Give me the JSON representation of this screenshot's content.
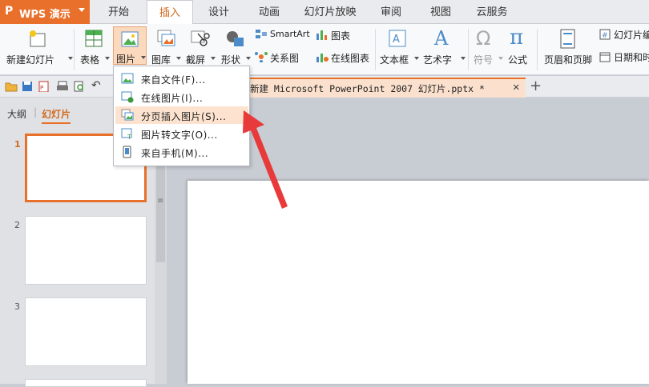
{
  "app": {
    "logo": "P",
    "name": "WPS 演示"
  },
  "tabs": [
    "开始",
    "插入",
    "设计",
    "动画",
    "幻灯片放映",
    "审阅",
    "视图",
    "云服务"
  ],
  "active_tab": "插入",
  "ribbon": {
    "new_slide": "新建幻灯片",
    "table": "表格",
    "picture": "图片",
    "gallery": "图库",
    "screenshot": "截屏",
    "shape": "形状",
    "smartart": "SmartArt",
    "chart": "图表",
    "relation": "关系图",
    "online_chart": "在线图表",
    "textbox": "文本框",
    "wordart": "艺术字",
    "symbol": "符号",
    "formula": "公式",
    "header_footer": "页眉和页脚",
    "slide_number": "幻灯片编",
    "datetime": "日期和时"
  },
  "document": {
    "tab_title": "新建 Microsoft PowerPoint 2007 幻灯片.pptx *"
  },
  "panel_tabs": {
    "outline": "大纲",
    "slides": "幻灯片"
  },
  "slide_numbers": [
    "1",
    "2",
    "3"
  ],
  "picture_menu": {
    "items": [
      "来自文件(F)...",
      "在线图片(I)...",
      "分页插入图片(S)...",
      "图片转文字(O)...",
      "来自手机(M)..."
    ],
    "highlighted_index": 2
  },
  "colors": {
    "accent": "#e8702a",
    "arrow": "#e83a3a",
    "highlight": "#fde3cf"
  }
}
